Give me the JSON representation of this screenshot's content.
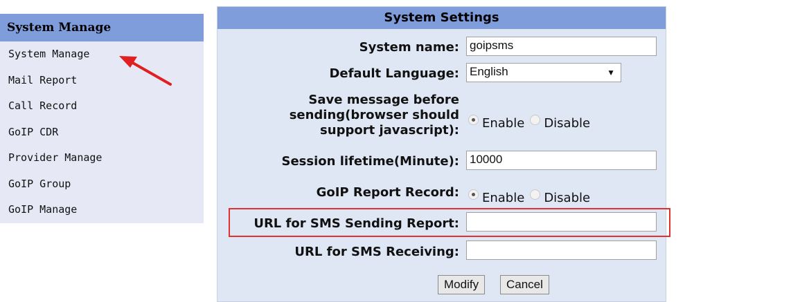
{
  "sidebar": {
    "header": "System Manage",
    "items": [
      {
        "label": "System Manage"
      },
      {
        "label": "Mail Report"
      },
      {
        "label": "Call Record"
      },
      {
        "label": "GoIP CDR"
      },
      {
        "label": "Provider Manage"
      },
      {
        "label": "GoIP Group"
      },
      {
        "label": "GoIP Manage"
      }
    ]
  },
  "panel": {
    "title": "System Settings",
    "system_name": {
      "label": "System name:",
      "value": "goipsms"
    },
    "default_language": {
      "label": "Default Language:",
      "value": "English"
    },
    "save_message": {
      "label_line1": "Save message before",
      "label_line2": "sending(browser should",
      "label_line3": "support javascript):",
      "options": [
        "Enable",
        "Disable"
      ],
      "selected": "Enable"
    },
    "session_lifetime": {
      "label": "Session lifetime(Minute):",
      "value": "10000"
    },
    "goip_report_record": {
      "label": "GoIP Report Record:",
      "options": [
        "Enable",
        "Disable"
      ],
      "selected": "Enable"
    },
    "url_sms_sending_report": {
      "label": "URL for SMS Sending Report:",
      "value": ""
    },
    "url_sms_receiving": {
      "label": "URL for SMS Receiving:",
      "value": ""
    },
    "buttons": {
      "modify": "Modify",
      "cancel": "Cancel"
    }
  },
  "colors": {
    "header_bg": "#7f9ddb",
    "panel_bg": "#dfe6f4",
    "sidebar_bg": "#e6e9f5",
    "highlight": "#e03030"
  }
}
